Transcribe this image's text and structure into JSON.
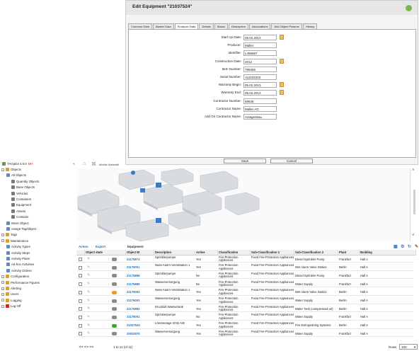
{
  "dialog": {
    "title": "Edit Equipment \"21037524\"",
    "tabs": [
      "Common Data",
      "Master Data",
      "Producer Data",
      "Details",
      "Status",
      "Description",
      "Associations",
      "Add Object Pictures",
      "History"
    ],
    "active_tab": "Producer Data",
    "fields": [
      {
        "label": "Start Up Date:",
        "value": "05.02.2013",
        "calendar": true
      },
      {
        "label": "Producer:",
        "value": "Müller",
        "calendar": false
      },
      {
        "label": "Identifier:",
        "value": "L456687",
        "calendar": false
      },
      {
        "label": "Construction Date:",
        "value": "2012",
        "calendar": true
      },
      {
        "label": "Item Number:",
        "value": "789456",
        "calendar": false
      },
      {
        "label": "Serial Number:",
        "value": "112233333",
        "calendar": false
      },
      {
        "label": "Warranty Begin:",
        "value": "05.02.2013",
        "calendar": true
      },
      {
        "label": "Warranty End:",
        "value": "05.02.2013",
        "calendar": true
      },
      {
        "label": "Contractor Number:",
        "value": "89635",
        "calendar": false
      },
      {
        "label": "Contractor Name:",
        "value": "Müller AG",
        "calendar": false
      },
      {
        "label": "Add On Contractor Name:",
        "value": "Anlagenbau",
        "calendar": false
      }
    ],
    "save_label": "Save",
    "cancel_label": "Cancel"
  },
  "sidebar": {
    "app_name": "TAGpilot 4.0.0",
    "app_badge": "MH",
    "items": [
      {
        "label": "Objects",
        "level": 0
      },
      {
        "label": "All Objects",
        "level": 1
      },
      {
        "label": "Quantity Objects",
        "level": 2
      },
      {
        "label": "Base Objects",
        "level": 2
      },
      {
        "label": "Vehicles",
        "level": 2
      },
      {
        "label": "Containers",
        "level": 2
      },
      {
        "label": "Equipment",
        "level": 2
      },
      {
        "label": "Assets",
        "level": 2
      },
      {
        "label": "Contacts",
        "level": 2
      },
      {
        "label": "Move Object",
        "level": 1
      },
      {
        "label": "Assign Tag/Object",
        "level": 1
      },
      {
        "label": "Tags",
        "level": 0
      },
      {
        "label": "Maintenance",
        "level": 0
      },
      {
        "label": "Activity Types",
        "level": 1
      },
      {
        "label": "Activity Steps",
        "level": 1
      },
      {
        "label": "Activity Plans",
        "level": 1
      },
      {
        "label": "Ad-hoc Activities",
        "level": 1
      },
      {
        "label": "Activity Orders",
        "level": 1
      },
      {
        "label": "Configuration",
        "level": 0
      },
      {
        "label": "Performance Figures",
        "level": 0
      },
      {
        "label": "Alerting",
        "level": 0
      },
      {
        "label": "Users",
        "level": 0
      },
      {
        "label": "Logging",
        "level": 0
      },
      {
        "label": "Log Off",
        "level": 0
      }
    ]
  },
  "toolbar": {
    "mobile_label": "Mobile Materialf"
  },
  "grid": {
    "action_label": "Action",
    "export_label": "Export",
    "section_label": "Equipment",
    "columns": [
      "",
      "Object state",
      "Object ID",
      "Description",
      "Active",
      "Classification",
      "Sub-Classification 1",
      "Sub-Classification 2",
      "Plant",
      "Building"
    ],
    "rows": [
      {
        "state": "gray",
        "id": "21175872",
        "desc": "Sprinklerpumpe",
        "active": "Yes",
        "cls": "Fire-Protection Appliances",
        "sub1": "Fixed Fire-Protection Appliances",
        "sub2": "Diesel Sprinkler Pump",
        "plant": "Frankfurt",
        "bld": "Hall A"
      },
      {
        "state": "gray",
        "id": "21176001",
        "desc": "Nass-Alarm-Ventilstation 1",
        "active": "Yes",
        "cls": "Fire-Protection Appliances",
        "sub1": "Fixed Fire-Protection Appliances",
        "sub2": "Wet Alarm Valve Station",
        "plant": "Berlin",
        "bld": "Hall A"
      },
      {
        "state": "gray",
        "id": "21175886",
        "desc": "Sprinklerpumpe",
        "active": "No",
        "cls": "Fire-Protection Appliances",
        "sub1": "Fixed Fire-Protection Appliances",
        "sub2": "Diesel Sprinkler Pump",
        "plant": "Frankfurt",
        "bld": "Hall A"
      },
      {
        "state": "gray",
        "id": "21175885",
        "desc": "Wasserversorgung",
        "active": "No",
        "cls": "Fire-Protection Appliances",
        "sub1": "Fixed Fire-Protection Appliances",
        "sub2": "Water Supply",
        "plant": "Frankfurt",
        "bld": "Hall A"
      },
      {
        "state": "orange",
        "id": "21176004",
        "desc": "Nass-Alarm-Ventilstation 1",
        "active": "Yes",
        "cls": "Fire-Protection Appliances",
        "sub1": "Fixed Fire-Protection Appliances",
        "sub2": "Wet Alarm Valve Station",
        "plant": "Berlin",
        "bld": "Hall A"
      },
      {
        "state": "gray",
        "id": "21176003",
        "desc": "Wasserversorgung",
        "active": "Yes",
        "cls": "Fire-Protection Appliances",
        "sub1": "Fixed Fire-Protection Appliances",
        "sub2": "Water Supply",
        "plant": "Berlin",
        "bld": "Hall A"
      },
      {
        "state": "gray",
        "id": "21175882",
        "desc": "Druckluft-Wassertank",
        "active": "Yes",
        "cls": "Fire-Protection Appliances",
        "sub1": "Fixed Fire-Protection Appliances",
        "sub2": "Water Tank (compressed air)",
        "plant": "Berlin",
        "bld": "Hall A"
      },
      {
        "state": "gray",
        "id": "21176001",
        "desc": "Sprinklerpumpe",
        "active": "No",
        "cls": "Fire-Protection Appliances",
        "sub1": "Fixed Fire-Protection Appliances",
        "sub2": "Water Supply",
        "plant": "Frankfurt",
        "bld": "Hall A"
      },
      {
        "state": "green",
        "id": "21037524",
        "desc": "Löschanlage 2032 A/B",
        "active": "Yes",
        "cls": "Fire-Protection Appliances",
        "sub1": "Fixed Fire-Protection Appliances",
        "sub2": "Fire Extinguishing Systems",
        "plant": "Berlin",
        "bld": "Hall A"
      },
      {
        "state": "gray",
        "id": "20010070",
        "desc": "Wasserversorgung",
        "active": "Yes",
        "cls": "Fire-Protection Appliances",
        "sub1": "Fixed Fire-Protection Appliances",
        "sub2": "Water Supply",
        "plant": "Frankfurt",
        "bld": "Hall A"
      }
    ],
    "paging_text": "1 to 11 (of 11)",
    "rows_label": "Rows",
    "rows_value": "100"
  },
  "colors": {
    "link": "#2a6fb0",
    "orange": "#e8a020",
    "green": "#4aa040",
    "gray": "#8a8a8a",
    "red": "#cc2222"
  }
}
